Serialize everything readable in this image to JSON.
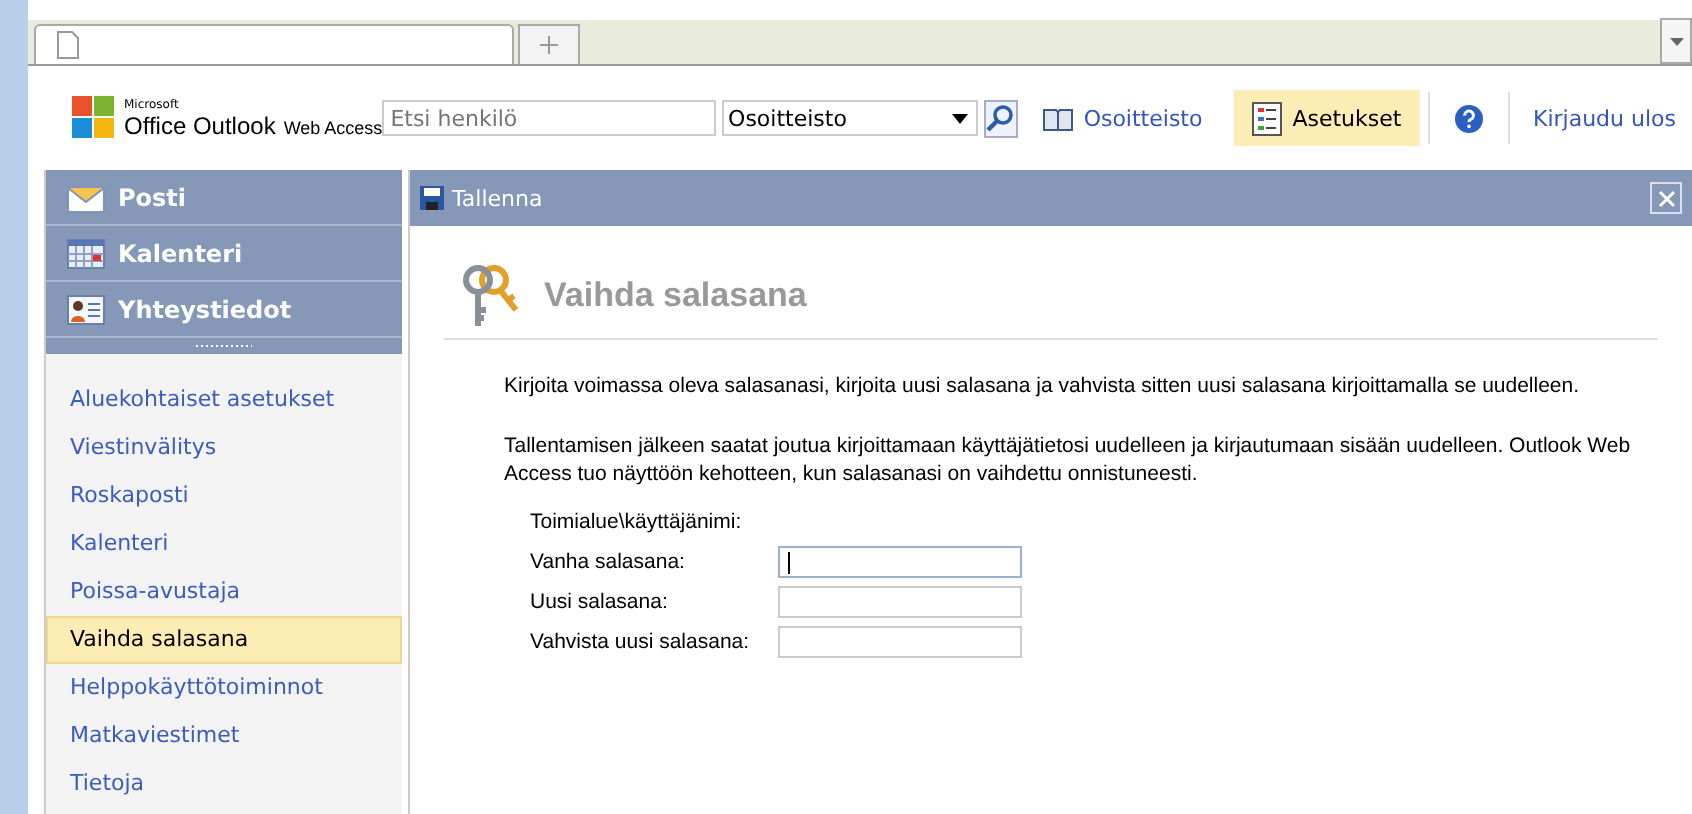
{
  "header": {
    "logo_small": "Microsoft",
    "logo_main": "Office Outlook",
    "logo_sub": "Web Access",
    "search": {
      "placeholder": "Etsi henkilö"
    },
    "directory_select": {
      "value": "Osoitteisto"
    },
    "links": [
      {
        "label": "Osoitteisto",
        "kind": "book",
        "selected": false
      },
      {
        "label": "Asetukset",
        "kind": "options",
        "selected": true
      },
      {
        "kind": "help",
        "selected": false
      },
      {
        "label": "Kirjaudu ulos",
        "kind": "plain",
        "selected": false
      }
    ]
  },
  "modules": [
    {
      "label": "Posti",
      "kind": "mail"
    },
    {
      "label": "Kalenteri",
      "kind": "calendar"
    },
    {
      "label": "Yhteystiedot",
      "kind": "contacts"
    }
  ],
  "options": [
    {
      "label": "Aluekohtaiset asetukset",
      "selected": false
    },
    {
      "label": "Viestinvälitys",
      "selected": false
    },
    {
      "label": "Roskaposti",
      "selected": false
    },
    {
      "label": "Kalenteri",
      "selected": false
    },
    {
      "label": "Poissa-avustaja",
      "selected": false
    },
    {
      "label": "Vaihda salasana",
      "selected": true
    },
    {
      "label": "Helppokäyttötoiminnot",
      "selected": false
    },
    {
      "label": "Matkaviestimet",
      "selected": false
    },
    {
      "label": "Tietoja",
      "selected": false
    }
  ],
  "toolbar": {
    "save": "Tallenna"
  },
  "page": {
    "title": "Vaihda salasana",
    "paragraphs": [
      "Kirjoita voimassa oleva salasanasi, kirjoita uusi salasana ja vahvista sitten uusi salasana kirjoittamalla se uudelleen.",
      "Tallentamisen jälkeen saatat joutua kirjoittamaan käyttäjätietosi uudelleen ja kirjautumaan sisään uudelleen. Outlook Web Access tuo näyttöön kehotteen, kun salasanasi on vaihdettu onnistuneesti."
    ],
    "fields": [
      {
        "label": "Toimialue\\käyttäjänimi:",
        "kind": "static"
      },
      {
        "label": "Vanha salasana:",
        "kind": "input",
        "focused": true
      },
      {
        "label": "Uusi salasana:",
        "kind": "input",
        "focused": false
      },
      {
        "label": "Vahvista uusi salasana:",
        "kind": "input",
        "focused": false
      }
    ]
  }
}
